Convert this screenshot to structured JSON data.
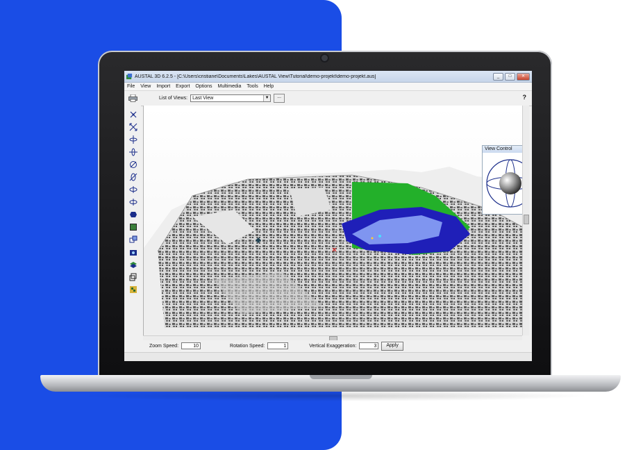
{
  "window": {
    "title": "AUSTAL 3D 6.2.5 - [C:\\Users\\cristiane\\Documents\\Lakes\\AUSTAL View\\Tutorial\\demo-projekt\\demo-projekt.aus]",
    "minimize": "_",
    "maximize": "□",
    "close": "✕"
  },
  "menu": {
    "items": [
      "File",
      "View",
      "Import",
      "Export",
      "Options",
      "Multimedia",
      "Tools",
      "Help"
    ]
  },
  "toolbar": {
    "list_of_views_label": "List of Views:",
    "list_of_views_value": "Last View",
    "dropdown_arrow": "▼",
    "more_label": "...",
    "help_label": "?"
  },
  "view_control": {
    "title": "View Control",
    "close": "x"
  },
  "bottom": {
    "zoom_label": "Zoom Speed:",
    "zoom_value": "10",
    "rotation_label": "Rotation Speed:",
    "rotation_value": "1",
    "exaggeration_label": "Vertical Exaggeration:",
    "exaggeration_value": "3",
    "apply_label": "Apply"
  },
  "colors": {
    "brand_blue": "#1a4de6",
    "plume_green": "#23b02a",
    "plume_blue": "#1f1fb8",
    "plume_light": "#7f95f0"
  },
  "icons": [
    "printer-icon",
    "select-icon",
    "zoom-extents-icon",
    "pan-icon",
    "rotate-icon",
    "tilt-icon",
    "orbit-icon",
    "spin-icon",
    "camera-icon",
    "layer-icon",
    "grid-icon"
  ]
}
